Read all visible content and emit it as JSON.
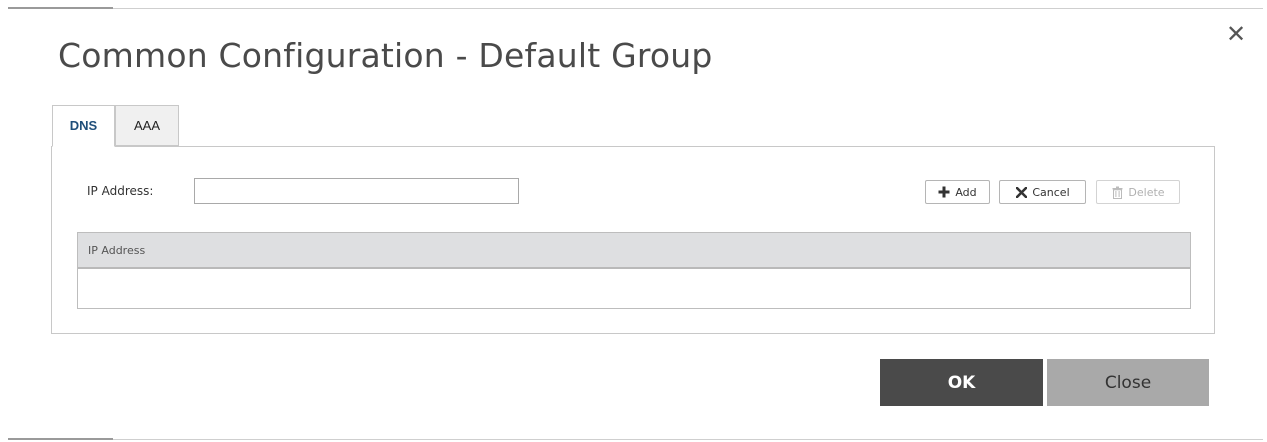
{
  "dialog": {
    "title": "Common Configuration - Default Group",
    "close_glyph": "✕"
  },
  "tabs": [
    {
      "label": "DNS",
      "active": true
    },
    {
      "label": "AAA",
      "active": false
    }
  ],
  "dns": {
    "ip_label": "IP Address:",
    "ip_value": "",
    "ip_placeholder": "",
    "actions": {
      "add_label": "Add",
      "add_icon": "plus-icon",
      "cancel_label": "Cancel",
      "cancel_icon": "x-icon",
      "delete_label": "Delete",
      "delete_icon": "trash-icon",
      "delete_enabled": false
    },
    "table": {
      "columns": [
        "IP Address"
      ],
      "rows": []
    }
  },
  "footer": {
    "ok_label": "OK",
    "close_label": "Close"
  },
  "colors": {
    "ok_bg": "#4a4a4a",
    "close_bg": "#a9a9a9",
    "active_tab_text": "#1f4e79",
    "table_header_bg": "#dedfe1"
  }
}
